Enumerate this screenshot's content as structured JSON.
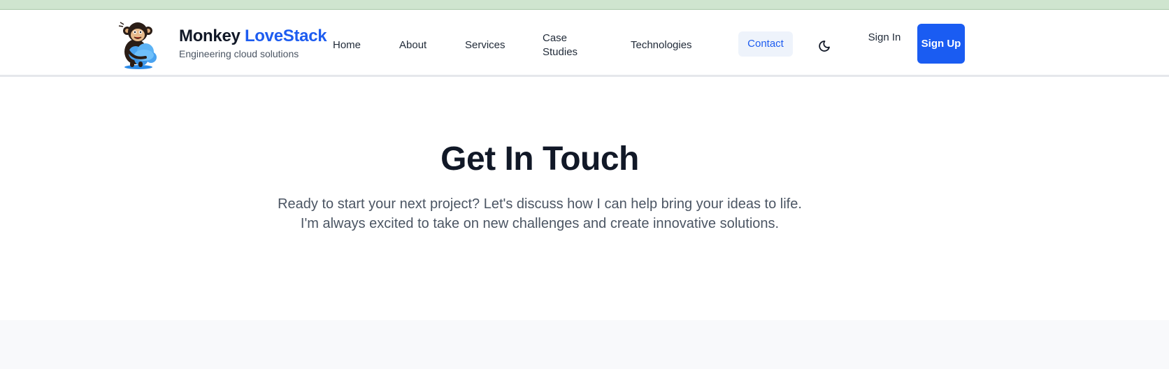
{
  "brand": {
    "name_part1": "Monkey",
    "name_part2": "LoveStack",
    "tagline": "Engineering cloud solutions",
    "logo_icon": "monkey-hugging-cloud-icon",
    "accent_color": "#1d5cf0"
  },
  "nav": {
    "items": [
      {
        "label": "Home"
      },
      {
        "label": "About"
      },
      {
        "label": "Services"
      },
      {
        "label": "Case Studies"
      },
      {
        "label": "Technologies"
      },
      {
        "label": "Contact",
        "active": true
      }
    ],
    "theme_toggle_icon": "moon-icon",
    "sign_in_label": "Sign In",
    "sign_up_label": "Sign Up"
  },
  "hero": {
    "title": "Get In Touch",
    "description": "Ready to start your next project? Let's discuss how I can help bring your ideas to life. I'm always excited to take on new challenges and create innovative solutions."
  }
}
